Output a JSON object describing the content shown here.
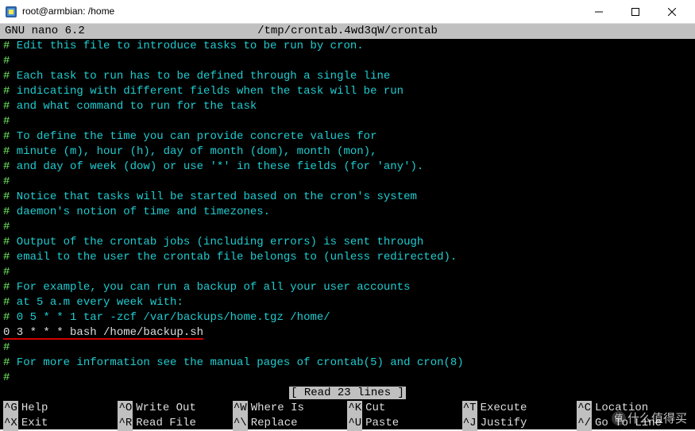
{
  "window": {
    "title": "root@armbian: /home"
  },
  "nano": {
    "version": "GNU  nano 6.2",
    "filepath": "/tmp/crontab.4wd3qW/crontab",
    "status": "[ Read 23 lines ]"
  },
  "lines": [
    {
      "h": "#",
      "t": " Edit this file to introduce tasks to be run by cron.",
      "c": true
    },
    {
      "h": "#",
      "t": " ",
      "c": true
    },
    {
      "h": "#",
      "t": " Each task to run has to be defined through a single line",
      "c": true
    },
    {
      "h": "#",
      "t": " indicating with different fields when the task will be run",
      "c": true
    },
    {
      "h": "#",
      "t": " and what command to run for the task",
      "c": true
    },
    {
      "h": "#",
      "t": " ",
      "c": true
    },
    {
      "h": "#",
      "t": " To define the time you can provide concrete values for",
      "c": true
    },
    {
      "h": "#",
      "t": " minute (m), hour (h), day of month (dom), month (mon),",
      "c": true
    },
    {
      "h": "#",
      "t": " and day of week (dow) or use '*' in these fields (for 'any').",
      "c": true
    },
    {
      "h": "#",
      "t": " ",
      "c": true
    },
    {
      "h": "#",
      "t": " Notice that tasks will be started based on the cron's system",
      "c": true
    },
    {
      "h": "#",
      "t": " daemon's notion of time and timezones.",
      "c": true
    },
    {
      "h": "#",
      "t": " ",
      "c": true
    },
    {
      "h": "#",
      "t": " Output of the crontab jobs (including errors) is sent through",
      "c": true
    },
    {
      "h": "#",
      "t": " email to the user the crontab file belongs to (unless redirected).",
      "c": true
    },
    {
      "h": "#",
      "t": " ",
      "c": true
    },
    {
      "h": "#",
      "t": " For example, you can run a backup of all your user accounts",
      "c": true
    },
    {
      "h": "#",
      "t": " at 5 a.m every week with:",
      "c": true
    },
    {
      "h": "#",
      "t": " 0 5 * * 1 tar -zcf /var/backups/home.tgz /home/",
      "c": true
    },
    {
      "h": "",
      "t": "0 3 * * * bash /home/backup.sh",
      "c": false,
      "u": true
    },
    {
      "h": "#",
      "t": " ",
      "c": true
    },
    {
      "h": "#",
      "t": " For more information see the manual pages of crontab(5) and cron(8)",
      "c": true
    },
    {
      "h": "#",
      "t": " ",
      "c": true
    }
  ],
  "shortcuts": {
    "row1": [
      {
        "key": "^G",
        "label": "Help"
      },
      {
        "key": "^O",
        "label": "Write Out"
      },
      {
        "key": "^W",
        "label": "Where Is"
      },
      {
        "key": "^K",
        "label": "Cut"
      },
      {
        "key": "^T",
        "label": "Execute"
      },
      {
        "key": "^C",
        "label": "Location"
      }
    ],
    "row2": [
      {
        "key": "^X",
        "label": "Exit"
      },
      {
        "key": "^R",
        "label": "Read File"
      },
      {
        "key": "^\\",
        "label": "Replace"
      },
      {
        "key": "^U",
        "label": "Paste"
      },
      {
        "key": "^J",
        "label": "Justify"
      },
      {
        "key": "^/",
        "label": "Go To Line"
      }
    ]
  },
  "watermark": {
    "text": "什么值得买",
    "badge": "值"
  }
}
